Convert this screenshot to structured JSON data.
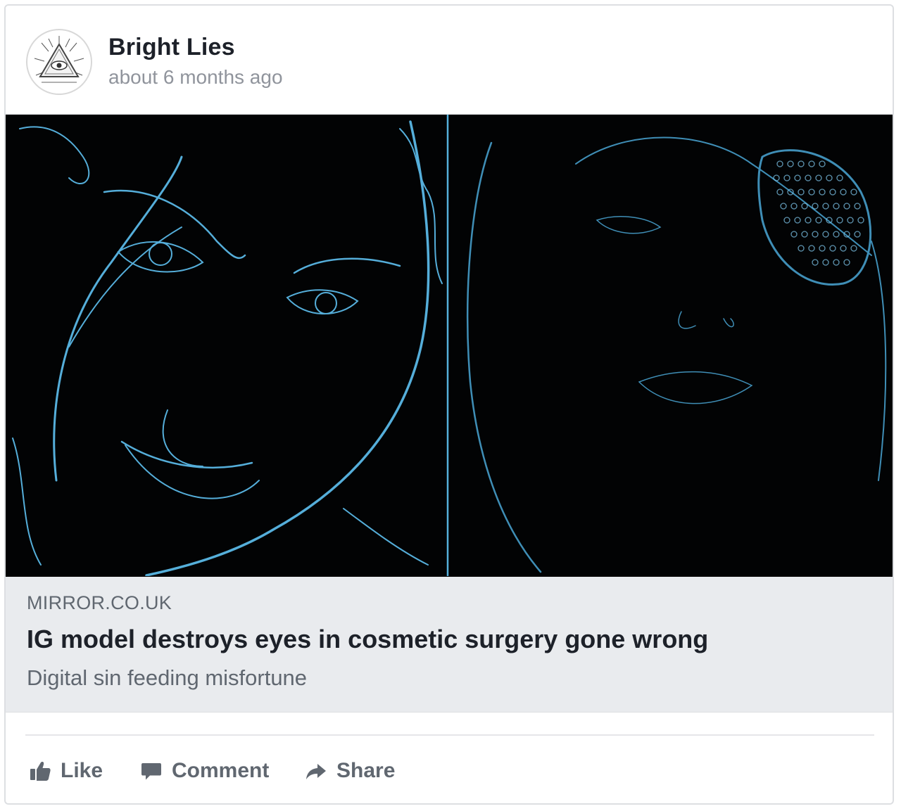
{
  "post": {
    "page_name": "Bright Lies",
    "timestamp": "about 6 months ago",
    "avatar_icon": "eye-of-providence-icon",
    "media_description_icon": "article-thumbnail-image"
  },
  "link_preview": {
    "domain": "MIRROR.CO.UK",
    "title": "IG model destroys eyes in cosmetic surgery gone wrong",
    "description": "Digital sin feeding misfortune"
  },
  "actions": {
    "like": {
      "label": "Like",
      "icon": "thumbs-up-icon"
    },
    "comment": {
      "label": "Comment",
      "icon": "speech-bubble-icon"
    },
    "share": {
      "label": "Share",
      "icon": "share-arrow-icon"
    }
  },
  "colors": {
    "text_primary": "#1d2129",
    "text_secondary": "#606770",
    "timestamp": "#90949c",
    "link_background": "#e9ebee",
    "border": "#dddfe2",
    "image_line": "#5ab8e6"
  }
}
